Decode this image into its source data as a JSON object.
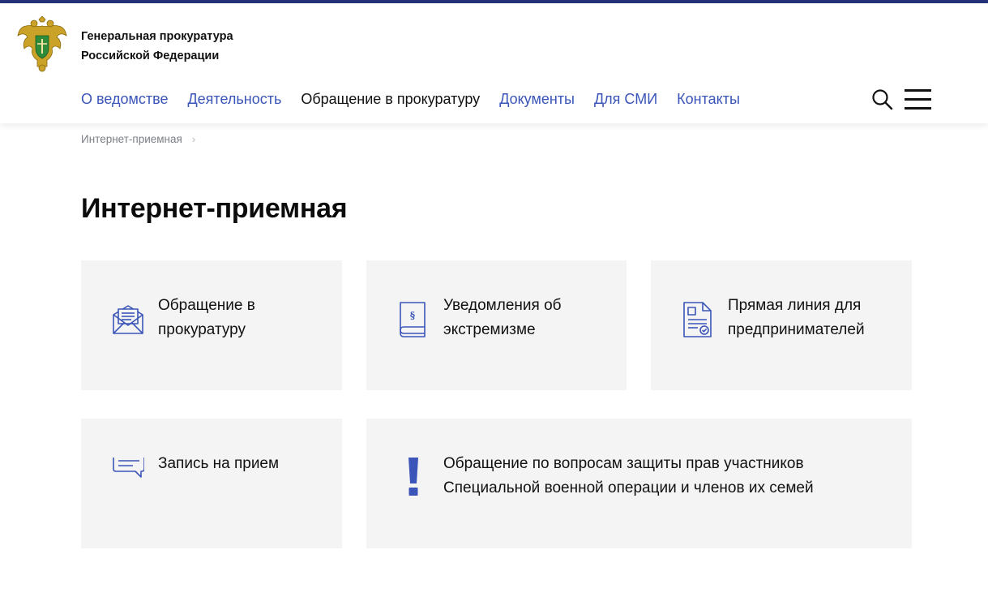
{
  "header": {
    "org_line1": "Генеральная прокуратура",
    "org_line2": "Российской Федерации",
    "emblem_icon": "coat-of-arms-emblem"
  },
  "nav": {
    "items": [
      {
        "label": "О ведомстве",
        "active": false
      },
      {
        "label": "Деятельность",
        "active": false
      },
      {
        "label": "Обращение в прокуратуру",
        "active": true
      },
      {
        "label": "Документы",
        "active": false
      },
      {
        "label": "Для СМИ",
        "active": false
      },
      {
        "label": "Контакты",
        "active": false
      }
    ],
    "search_icon": "search-icon",
    "menu_icon": "hamburger-menu-icon"
  },
  "breadcrumb": {
    "items": [
      "Интернет-приемная"
    ],
    "separator": "›"
  },
  "page": {
    "title": "Интернет-приемная"
  },
  "cards": [
    {
      "line1": "Обращение в",
      "line2": "прокуратуру",
      "icon": "envelope-letter-icon"
    },
    {
      "line1": "Уведомления об",
      "line2": "экстремизме",
      "icon": "law-book-icon"
    },
    {
      "line1": "Прямая линия для",
      "line2": "предпринимателей",
      "icon": "certificate-document-icon"
    },
    {
      "line1": "Запись на прием",
      "line2": "",
      "icon": "chat-message-icon"
    },
    {
      "line1": "Обращение по вопросам защиты прав участников",
      "line2": "Специальной военной операции и членов их семей",
      "icon": "exclamation-icon"
    }
  ],
  "colors": {
    "accent": "#3b55b8",
    "topbar": "#24337a",
    "card_bg": "#f4f4f4",
    "text": "#111111"
  }
}
